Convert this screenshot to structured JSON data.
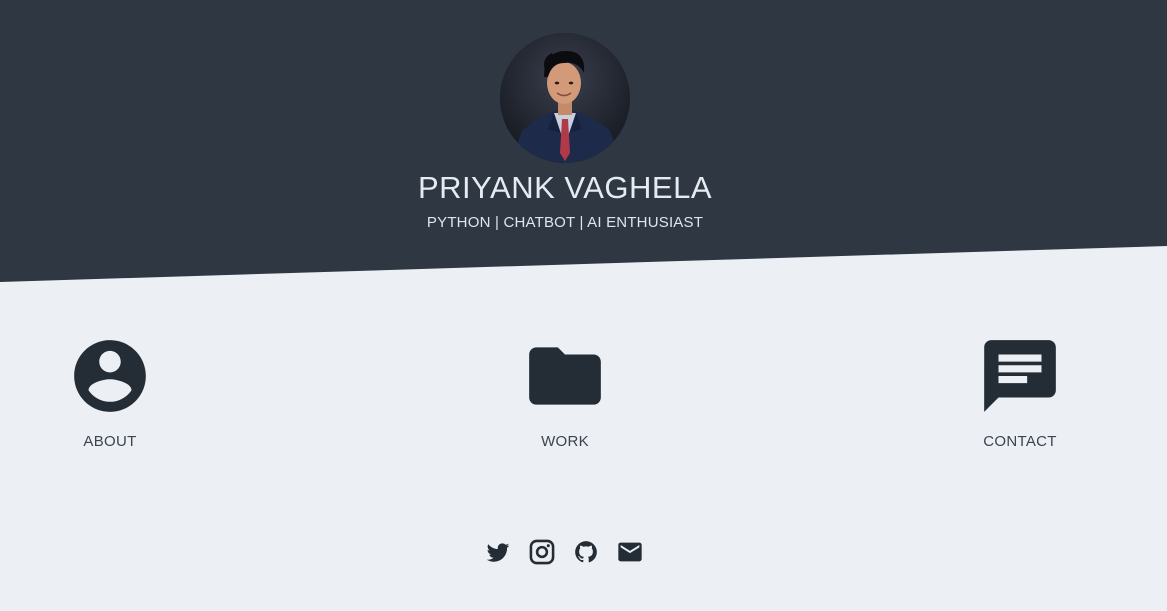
{
  "hero": {
    "name": "PRIYANK VAGHELA",
    "tagline": "PYTHON | CHATBOT | AI ENTHUSIAST"
  },
  "nav": {
    "items": [
      {
        "label": "ABOUT",
        "icon": "account-circle-icon"
      },
      {
        "label": "WORK",
        "icon": "folder-icon"
      },
      {
        "label": "CONTACT",
        "icon": "message-icon"
      }
    ]
  },
  "social": {
    "items": [
      {
        "icon": "twitter-icon"
      },
      {
        "icon": "instagram-icon"
      },
      {
        "icon": "github-icon"
      },
      {
        "icon": "mail-icon"
      }
    ]
  },
  "colors": {
    "hero_bg": "#2e3742",
    "page_bg": "#eceff4",
    "icon": "#242c35",
    "hero_text": "#e6ebf2"
  }
}
